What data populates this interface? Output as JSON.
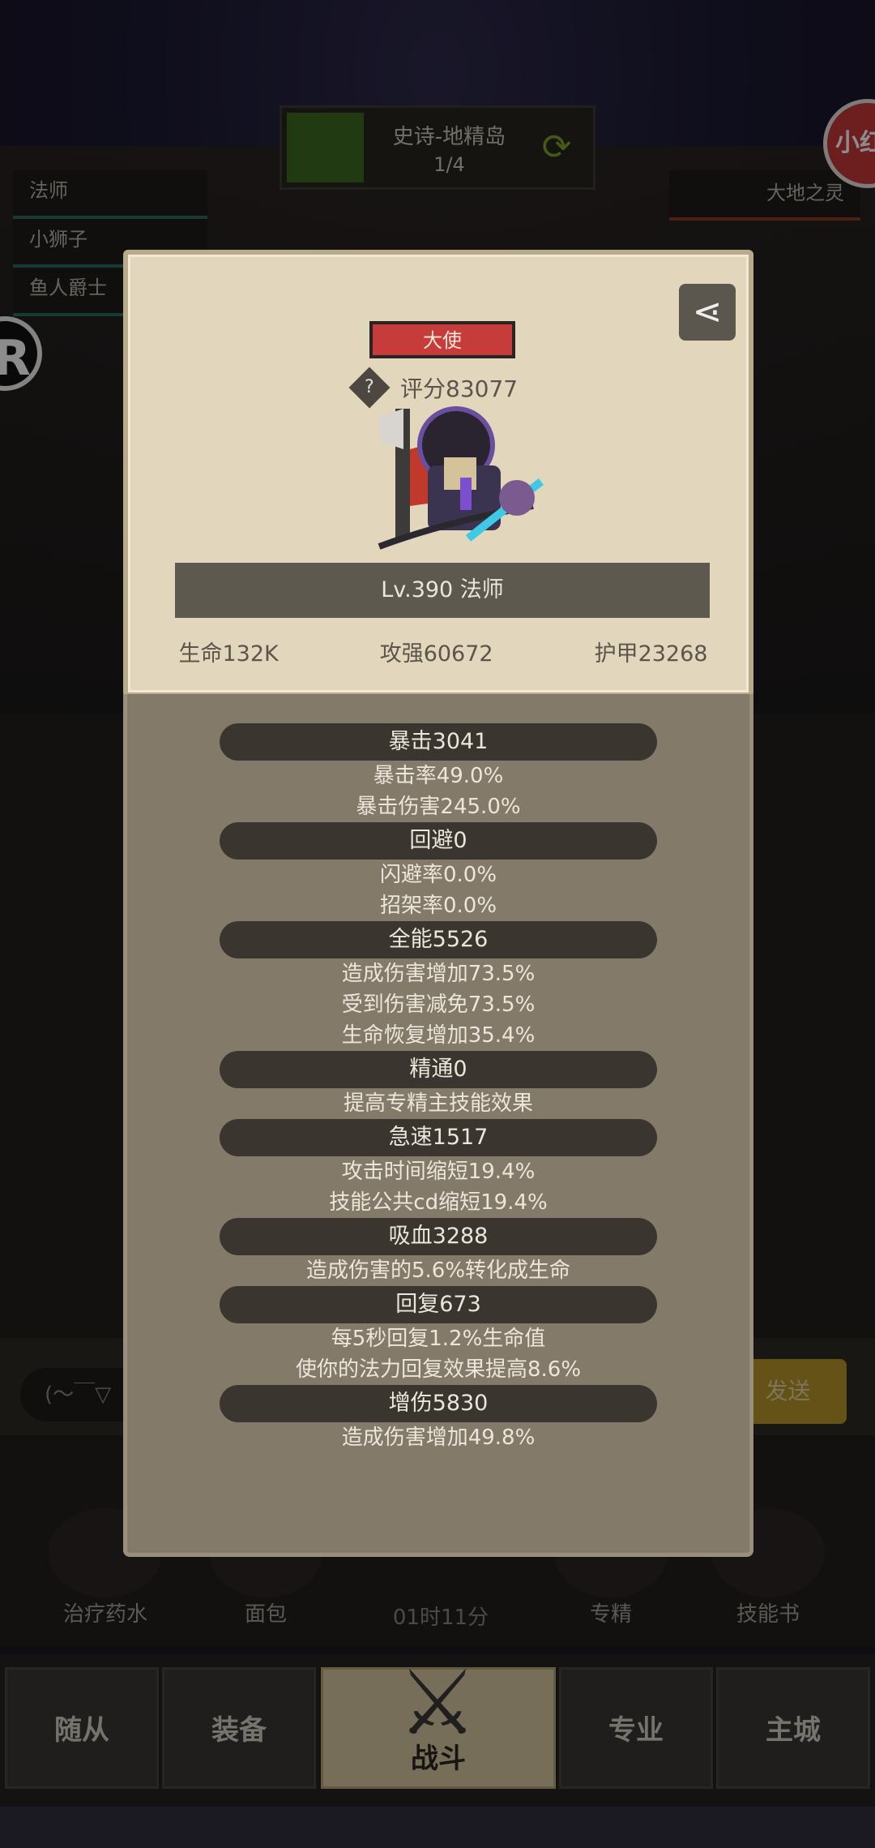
{
  "stage": {
    "title": "史诗-地精岛",
    "progress": "1/4"
  },
  "team": [
    "法师",
    "小狮子",
    "鱼人爵士"
  ],
  "boss": "大地之灵",
  "xiaohong_label": "小红",
  "chat": {
    "input_text": "(～￣▽",
    "send_label": "发送"
  },
  "bottom_items": [
    "治疗药水",
    "面包",
    "专精",
    "技能书"
  ],
  "timer": "01时11分",
  "tabs": [
    "随从",
    "装备",
    "战斗",
    "专业",
    "主城"
  ],
  "modal": {
    "title_badge": "大使",
    "score_text": "评分83077",
    "level_text": "Lv.390 法师",
    "summary": [
      "生命132K",
      "攻强60672",
      "护甲23268"
    ],
    "stats": [
      {
        "header": "暴击3041",
        "lines": [
          "暴击率49.0%",
          "暴击伤害245.0%"
        ]
      },
      {
        "header": "回避0",
        "lines": [
          "闪避率0.0%",
          "招架率0.0%"
        ]
      },
      {
        "header": "全能5526",
        "lines": [
          "造成伤害增加73.5%",
          "受到伤害减免73.5%",
          "生命恢复增加35.4%"
        ]
      },
      {
        "header": "精通0",
        "lines": [
          "提高专精主技能效果"
        ]
      },
      {
        "header": "急速1517",
        "lines": [
          "攻击时间缩短19.4%",
          "技能公共cd缩短19.4%"
        ]
      },
      {
        "header": "吸血3288",
        "lines": [
          "造成伤害的5.6%转化成生命"
        ]
      },
      {
        "header": "回复673",
        "lines": [
          "每5秒回复1.2%生命值",
          "使你的法力回复效果提高8.6%"
        ]
      },
      {
        "header": "增伤5830",
        "lines": [
          "造成伤害增加49.8%"
        ]
      }
    ]
  },
  "icons": {
    "share": "share-icon",
    "help": "help-icon",
    "refresh": "refresh-icon"
  }
}
